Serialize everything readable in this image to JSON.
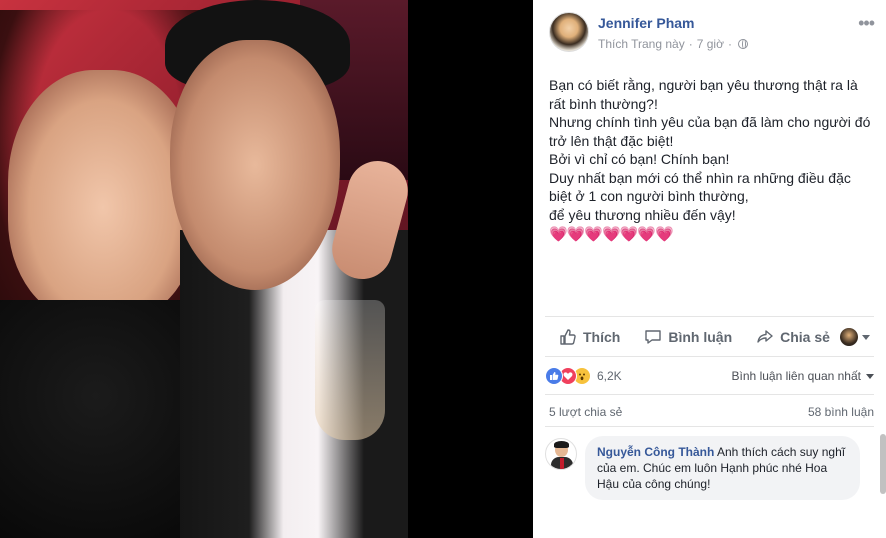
{
  "post": {
    "author": "Jennifer Pham",
    "page_like": "Thích Trang này",
    "separator": "·",
    "time": "7 giờ",
    "more_label": "•••",
    "body_lines": [
      "Bạn có biết rằng, người bạn yêu thương thật ra là",
      "rất bình thường?!",
      "Nhưng chính tình yêu của bạn đã làm cho người đó",
      "trở lên thật đặc biệt!",
      "Bởi vì chỉ có bạn! Chính bạn!",
      "Duy nhất bạn mới có thể nhìn ra những điều đặc",
      "biệt ở 1 con người bình thường,",
      "để yêu thương nhiều đến vậy!"
    ],
    "hearts": "💗💗💗💗💗💗💗"
  },
  "actions": {
    "like": "Thích",
    "comment": "Bình luận",
    "share": "Chia sẻ"
  },
  "reactions": {
    "count": "6,2K",
    "sort_label": "Bình luận liên quan nhất"
  },
  "stats": {
    "shares": "5 lượt chia sẻ",
    "comments": "58 bình luận"
  },
  "comment": {
    "name": "Nguyễn Công Thành",
    "text": "Anh thích cách suy nghĩ của em. Chúc em luôn Hạnh phúc nhé Hoa Hậu của công chúng!"
  },
  "colors": {
    "link": "#365899",
    "meta": "#90949c",
    "like_reaction": "#4a7ce8",
    "love_reaction": "#f0405d",
    "wow_reaction": "#f7c23c"
  }
}
